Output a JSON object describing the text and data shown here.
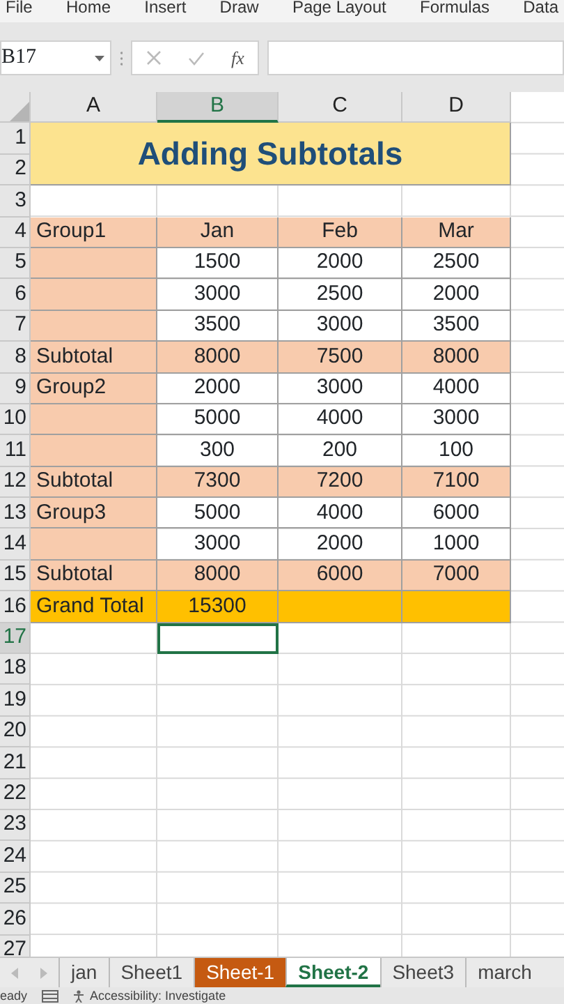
{
  "menu": [
    "File",
    "Home",
    "Insert",
    "Draw",
    "Page Layout",
    "Formulas",
    "Data"
  ],
  "formula_bar": {
    "name_box": "B17",
    "fx": "fx"
  },
  "columns": [
    {
      "label": "A",
      "selected": false
    },
    {
      "label": "B",
      "selected": true
    },
    {
      "label": "C",
      "selected": false
    },
    {
      "label": "D",
      "selected": false
    }
  ],
  "title": "Adding Subtotals",
  "rows": [
    {
      "number": "1",
      "kind": "title",
      "selected": false,
      "cells": []
    },
    {
      "number": "2",
      "kind": "title",
      "selected": false,
      "cells": []
    },
    {
      "number": "3",
      "kind": "empty",
      "selected": false,
      "cells": []
    },
    {
      "number": "4",
      "kind": "header",
      "selected": false,
      "cells": [
        "Group1",
        "Jan",
        "Feb",
        "Mar"
      ]
    },
    {
      "number": "5",
      "kind": "data",
      "selected": false,
      "cells": [
        "",
        "1500",
        "2000",
        "2500"
      ]
    },
    {
      "number": "6",
      "kind": "data",
      "selected": false,
      "cells": [
        "",
        "3000",
        "2500",
        "2000"
      ]
    },
    {
      "number": "7",
      "kind": "data",
      "selected": false,
      "cells": [
        "",
        "3500",
        "3000",
        "3500"
      ]
    },
    {
      "number": "8",
      "kind": "subtotal",
      "selected": false,
      "cells": [
        "Subtotal",
        "8000",
        "7500",
        "8000"
      ]
    },
    {
      "number": "9",
      "kind": "data",
      "selected": false,
      "cells": [
        "Group2",
        "2000",
        "3000",
        "4000"
      ]
    },
    {
      "number": "10",
      "kind": "data",
      "selected": false,
      "cells": [
        "",
        "5000",
        "4000",
        "3000"
      ]
    },
    {
      "number": "11",
      "kind": "data",
      "selected": false,
      "cells": [
        "",
        "300",
        "200",
        "100"
      ]
    },
    {
      "number": "12",
      "kind": "subtotal",
      "selected": false,
      "cells": [
        "Subtotal",
        "7300",
        "7200",
        "7100"
      ]
    },
    {
      "number": "13",
      "kind": "data",
      "selected": false,
      "cells": [
        "Group3",
        "5000",
        "4000",
        "6000"
      ]
    },
    {
      "number": "14",
      "kind": "data",
      "selected": false,
      "cells": [
        "",
        "3000",
        "2000",
        "1000"
      ]
    },
    {
      "number": "15",
      "kind": "subtotal",
      "selected": false,
      "cells": [
        "Subtotal",
        "8000",
        "6000",
        "7000"
      ]
    },
    {
      "number": "16",
      "kind": "grand_total",
      "selected": false,
      "cells": [
        "Grand Total",
        "15300",
        "",
        ""
      ]
    },
    {
      "number": "17",
      "kind": "empty",
      "selected": true,
      "cells": []
    },
    {
      "number": "18",
      "kind": "empty",
      "selected": false,
      "cells": []
    },
    {
      "number": "19",
      "kind": "empty",
      "selected": false,
      "cells": []
    },
    {
      "number": "20",
      "kind": "empty",
      "selected": false,
      "cells": []
    },
    {
      "number": "21",
      "kind": "empty",
      "selected": false,
      "cells": []
    },
    {
      "number": "22",
      "kind": "empty",
      "selected": false,
      "cells": []
    },
    {
      "number": "23",
      "kind": "empty",
      "selected": false,
      "cells": []
    },
    {
      "number": "24",
      "kind": "empty",
      "selected": false,
      "cells": []
    },
    {
      "number": "25",
      "kind": "empty",
      "selected": false,
      "cells": []
    },
    {
      "number": "26",
      "kind": "empty",
      "selected": false,
      "cells": []
    },
    {
      "number": "27",
      "kind": "empty",
      "selected": false,
      "cells": []
    }
  ],
  "sheet_tabs": [
    {
      "label": "jan",
      "selected": false
    },
    {
      "label": "Sheet1",
      "selected": false
    },
    {
      "label": "Sheet-1",
      "selected": false,
      "color": "#c55a11"
    },
    {
      "label": "Sheet-2",
      "selected": true
    },
    {
      "label": "Sheet3",
      "selected": false
    },
    {
      "label": "march",
      "selected": false
    }
  ],
  "status_bar": {
    "mode": "eady",
    "accessibility": "Accessibility: Investigate"
  }
}
